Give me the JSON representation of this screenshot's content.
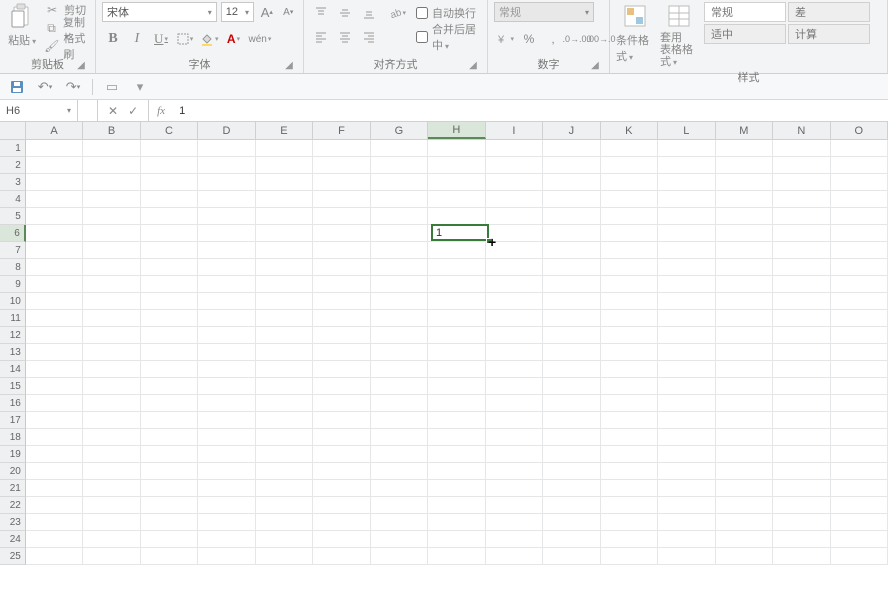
{
  "ribbon": {
    "clipboard": {
      "paste_label": "粘贴",
      "cut_label": "剪切",
      "copy_label": "复制",
      "format_painter_label": "格式刷",
      "group_label": "剪贴板"
    },
    "font": {
      "name": "宋体",
      "size": "12",
      "grow_tip": "A",
      "shrink_tip": "A",
      "group_label": "字体"
    },
    "alignment": {
      "wrap_label": "自动换行",
      "merge_label": "合并后居中",
      "group_label": "对齐方式"
    },
    "number": {
      "format": "常规",
      "group_label": "数字"
    },
    "styles": {
      "cond_format_label": "条件格式",
      "table_format_label": "套用\n表格格式",
      "preset_normal": "常规",
      "preset_bad": "差",
      "preset_good": "适中",
      "preset_calc": "计算",
      "group_label": "样式"
    }
  },
  "name_box": "H6",
  "formula_value": "1",
  "columns": [
    "A",
    "B",
    "C",
    "D",
    "E",
    "F",
    "G",
    "H",
    "I",
    "J",
    "K",
    "L",
    "M",
    "N",
    "O"
  ],
  "active_col": "H",
  "active_row": 6,
  "row_count": 25,
  "active_cell_value": "1"
}
